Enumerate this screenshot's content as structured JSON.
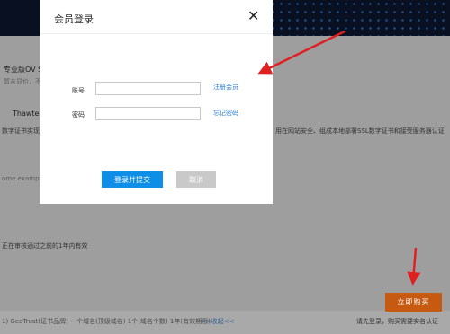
{
  "background": {
    "texts": [
      "专业版OV S",
      "暂未显价，不做说明",
      "Thawte",
      "数字证书实现",
      "用在网站安全、组成本地部署SSL数字证书和接受服务器认证",
      "ome.example.c",
      "正在审核通过之前的1年内有效",
      "1) GeoTrust(证书品牌)  一个域名(顶级域名)  1个(域名个数)  1年(有效期限)",
      ">>收起<<"
    ]
  },
  "modal": {
    "title": "会员登录",
    "close_symbol": "✕",
    "account_label": "账号",
    "password_label": "密码",
    "account_value": "",
    "password_value": "",
    "register_link": "注册会员",
    "forgot_link": "忘记密码",
    "submit_label": "登录并提交",
    "cancel_label": "取消"
  },
  "footer": {
    "buy_label": "立即购买",
    "hint": "请先登录，购买需要实名认证"
  },
  "colors": {
    "primary": "#0e8ee6",
    "buy": "#c65a10",
    "arrow": "#e02020",
    "link": "#2e7fd6"
  }
}
